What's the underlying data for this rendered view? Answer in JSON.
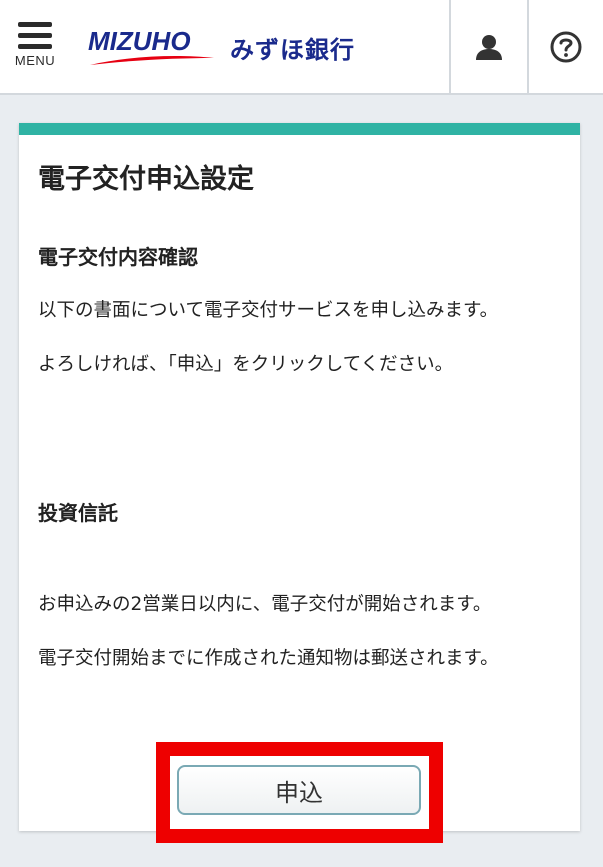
{
  "header": {
    "menu_label": "MENU",
    "logo_text": "MIZUHO",
    "bank_name": "みずほ銀行",
    "user_icon": "user-icon",
    "help_icon": "help-icon"
  },
  "card": {
    "title": "電子交付申込設定",
    "section1_heading": "電子交付内容確認",
    "section1_text1": "以下の書面について電子交付サービスを申し込みます。",
    "section1_text2": "よろしければ、「申込」をクリックしてください。",
    "section2_heading": "投資信託",
    "section2_text1": "お申込みの2営業日以内に、電子交付が開始されます。",
    "section2_text2": "電子交付開始までに作成された通知物は郵送されます。",
    "apply_label": "申込"
  },
  "colors": {
    "accent": "#2fb3a4",
    "brand": "#1a2a8c",
    "brand_red": "#e60012",
    "highlight": "#ee0000"
  }
}
